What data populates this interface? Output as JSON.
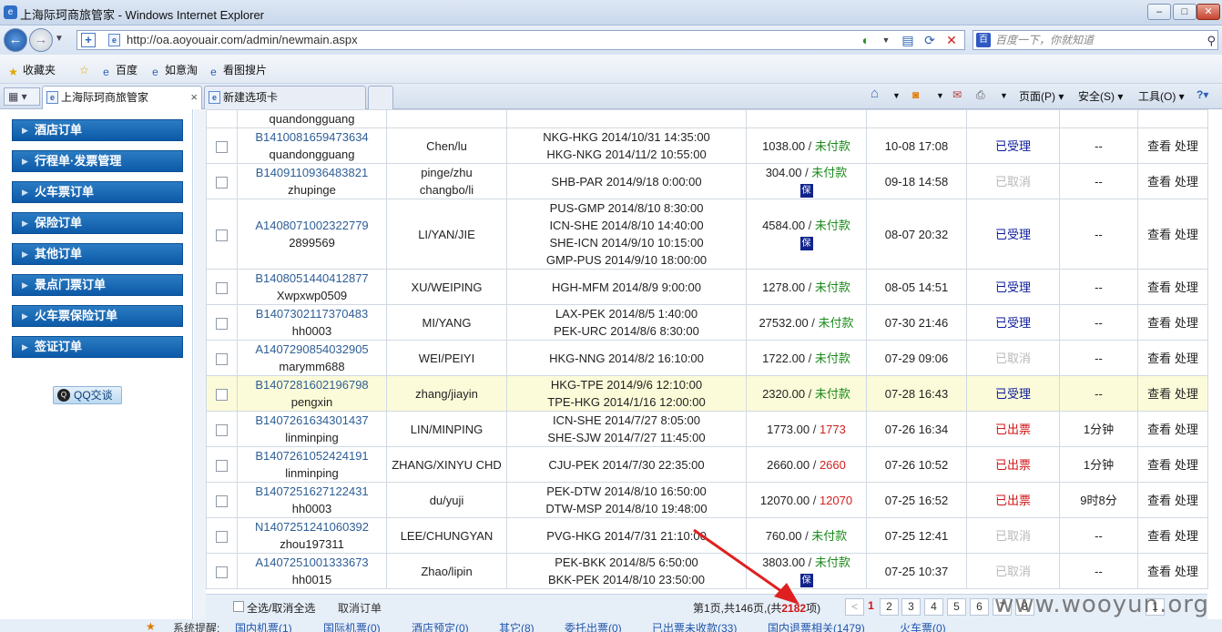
{
  "window": {
    "title": "上海际珂商旅管家 - Windows Internet Explorer"
  },
  "address": {
    "url": "http://oa.aoyouair.com/admin/newmain.aspx",
    "search_placeholder": "百度一下，你就知道"
  },
  "favorites": {
    "favorites_label": "收藏夹",
    "items": [
      "百度",
      "如意淘",
      "看图搜片"
    ]
  },
  "tabs": [
    {
      "label": "上海际珂商旅管家"
    },
    {
      "label": "新建选项卡"
    }
  ],
  "commands": {
    "page": "页面(P)",
    "safety": "安全(S)",
    "tools": "工具(O)"
  },
  "sidebar": {
    "items": [
      "酒店订单",
      "行程单·发票管理",
      "火车票订单",
      "保险订单",
      "其他订单",
      "景点门票订单",
      "火车票保险订单",
      "签证订单"
    ],
    "qq": "QQ交谈"
  },
  "orders": {
    "partial_top": {
      "user": "quandongguang"
    },
    "rows": [
      {
        "order_id": "B1410081659473634",
        "user": "quandongguang",
        "passenger": [
          "Chen/lu"
        ],
        "itinerary": [
          "NKG-HKG 2014/10/31 14:35:00",
          "HKG-NKG 2014/11/2 10:55:00"
        ],
        "amount": "1038.00",
        "pay": "未付款",
        "pay_type": "unpaid",
        "insured": false,
        "time": "10-08 17:08",
        "status": "已受理",
        "status_type": "accepted",
        "duration": "--"
      },
      {
        "order_id": "B1409110936483821",
        "user": "zhupinge",
        "passenger": [
          "pinge/zhu",
          "changbo/li"
        ],
        "itinerary": [
          "SHB-PAR 2014/9/18 0:00:00"
        ],
        "amount": "304.00",
        "pay": "未付款",
        "pay_type": "unpaid",
        "insured": true,
        "time": "09-18 14:58",
        "status": "已取消",
        "status_type": "cancel",
        "duration": "--"
      },
      {
        "order_id": "A1408071002322779",
        "user": "2899569",
        "passenger": [
          "LI/YAN/JIE"
        ],
        "itinerary": [
          "PUS-GMP 2014/8/10 8:30:00",
          "ICN-SHE 2014/8/10 14:40:00",
          "SHE-ICN 2014/9/10 10:15:00",
          "GMP-PUS 2014/9/10 18:00:00"
        ],
        "amount": "4584.00",
        "pay": "未付款",
        "pay_type": "unpaid",
        "insured": true,
        "time": "08-07 20:32",
        "status": "已受理",
        "status_type": "accepted",
        "duration": "--"
      },
      {
        "order_id": "B1408051440412877",
        "user": "Xwpxwp0509",
        "passenger": [
          "XU/WEIPING"
        ],
        "itinerary": [
          "HGH-MFM 2014/8/9 9:00:00"
        ],
        "amount": "1278.00",
        "pay": "未付款",
        "pay_type": "unpaid",
        "insured": false,
        "time": "08-05 14:51",
        "status": "已受理",
        "status_type": "accepted",
        "duration": "--"
      },
      {
        "order_id": "B1407302117370483",
        "user": "hh0003",
        "passenger": [
          "MI/YANG"
        ],
        "itinerary": [
          "LAX-PEK 2014/8/5 1:40:00",
          "PEK-URC 2014/8/6 8:30:00"
        ],
        "amount": "27532.00",
        "pay": "未付款",
        "pay_type": "unpaid",
        "insured": false,
        "time": "07-30 21:46",
        "status": "已受理",
        "status_type": "accepted",
        "duration": "--"
      },
      {
        "order_id": "A1407290854032905",
        "user": "marymm688",
        "passenger": [
          "WEI/PEIYI"
        ],
        "itinerary": [
          "HKG-NNG 2014/8/2 16:10:00"
        ],
        "amount": "1722.00",
        "pay": "未付款",
        "pay_type": "unpaid",
        "insured": false,
        "time": "07-29 09:06",
        "status": "已取消",
        "status_type": "cancel",
        "duration": "--"
      },
      {
        "order_id": "B1407281602196798",
        "user": "pengxin",
        "passenger": [
          "zhang/jiayin"
        ],
        "itinerary": [
          "HKG-TPE 2014/9/6 12:10:00",
          "TPE-HKG 2014/1/16 12:00:00"
        ],
        "amount": "2320.00",
        "pay": "未付款",
        "pay_type": "unpaid",
        "insured": false,
        "time": "07-28 16:43",
        "status": "已受理",
        "status_type": "accepted",
        "duration": "--",
        "highlight": true
      },
      {
        "order_id": "B1407261634301437",
        "user": "linminping",
        "passenger": [
          "LIN/MINPING"
        ],
        "itinerary": [
          "ICN-SHE 2014/7/27 8:05:00",
          "SHE-SJW 2014/7/27 11:45:00"
        ],
        "amount": "1773.00",
        "pay": "1773",
        "pay_type": "paid",
        "insured": false,
        "time": "07-26 16:34",
        "status": "已出票",
        "status_type": "issued",
        "duration": "1分钟"
      },
      {
        "order_id": "B1407261052424191",
        "user": "linminping",
        "passenger": [
          "ZHANG/XINYU CHD"
        ],
        "itinerary": [
          "CJU-PEK 2014/7/30 22:35:00"
        ],
        "amount": "2660.00",
        "pay": "2660",
        "pay_type": "paid",
        "insured": false,
        "time": "07-26 10:52",
        "status": "已出票",
        "status_type": "issued",
        "duration": "1分钟"
      },
      {
        "order_id": "B1407251627122431",
        "user": "hh0003",
        "passenger": [
          "du/yuji"
        ],
        "itinerary": [
          "PEK-DTW 2014/8/10 16:50:00",
          "DTW-MSP 2014/8/10 19:48:00"
        ],
        "amount": "12070.00",
        "pay": "12070",
        "pay_type": "paid",
        "insured": false,
        "time": "07-25 16:52",
        "status": "已出票",
        "status_type": "issued",
        "duration": "9时8分"
      },
      {
        "order_id": "N1407251241060392",
        "user": "zhou197311",
        "passenger": [
          "LEE/CHUNGYAN"
        ],
        "itinerary": [
          "PVG-HKG 2014/7/31 21:10:00"
        ],
        "amount": "760.00",
        "pay": "未付款",
        "pay_type": "unpaid",
        "insured": false,
        "time": "07-25 12:41",
        "status": "已取消",
        "status_type": "cancel",
        "duration": "--"
      },
      {
        "order_id": "A1407251001333673",
        "user": "hh0015",
        "passenger": [
          "Zhao/lipin"
        ],
        "itinerary": [
          "PEK-BKK 2014/8/5 6:50:00",
          "BKK-PEK 2014/8/10 23:50:00"
        ],
        "amount": "3803.00",
        "pay": "未付款",
        "pay_type": "unpaid",
        "insured": true,
        "time": "07-25 10:37",
        "status": "已取消",
        "status_type": "cancel",
        "duration": "--"
      }
    ],
    "insured_mark": "保",
    "view_label": "查看",
    "process_label": "处理"
  },
  "footer": {
    "select_all": "全选/取消全选",
    "cancel_order": "取消订单",
    "page_info_prefix": "第1页,共146页,(共",
    "total": "2182",
    "page_info_suffix": "项)",
    "prev": "<",
    "pages": [
      "1",
      "2",
      "3",
      "4",
      "5",
      "6",
      "7",
      "8"
    ],
    "current_page": "1",
    "last": "1"
  },
  "status_strip": {
    "label": "系统提醒:",
    "items": [
      "国内机票(1)",
      "国际机票(0)",
      "酒店预定(0)",
      "其它(8)",
      "委托出票(0)",
      "已出票未收款(33)",
      "国内退票相关(1479)",
      "火车票(0)"
    ]
  },
  "watermark": "www.wooyun.org"
}
